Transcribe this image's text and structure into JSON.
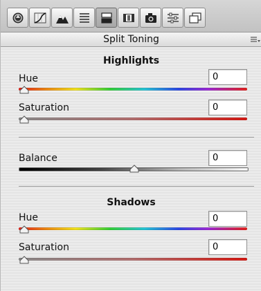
{
  "toolbar": {
    "tools": [
      {
        "icon": "aperture-icon"
      },
      {
        "icon": "tone-curve-icon"
      },
      {
        "icon": "detail-mountains-icon"
      },
      {
        "icon": "hsl-grayscale-icon"
      },
      {
        "icon": "split-toning-icon",
        "active": true
      },
      {
        "icon": "lens-corrections-icon"
      },
      {
        "icon": "camera-calibration-icon"
      },
      {
        "icon": "presets-sliders-icon"
      },
      {
        "icon": "snapshots-icon"
      }
    ]
  },
  "panel": {
    "title": "Split Toning",
    "menu_icon": "panel-menu-icon"
  },
  "highlights": {
    "heading": "Highlights",
    "hue": {
      "label": "Hue",
      "value": "0",
      "level": 0
    },
    "saturation": {
      "label": "Saturation",
      "value": "0",
      "level": 0
    }
  },
  "balance": {
    "label": "Balance",
    "value": "0",
    "level": 0.5
  },
  "shadows": {
    "heading": "Shadows",
    "hue": {
      "label": "Hue",
      "value": "0",
      "level": 0
    },
    "saturation": {
      "label": "Saturation",
      "value": "0",
      "level": 0
    }
  },
  "colors": {
    "panel_bg": "#ebebeb",
    "saturation_end": "#d81a14"
  }
}
